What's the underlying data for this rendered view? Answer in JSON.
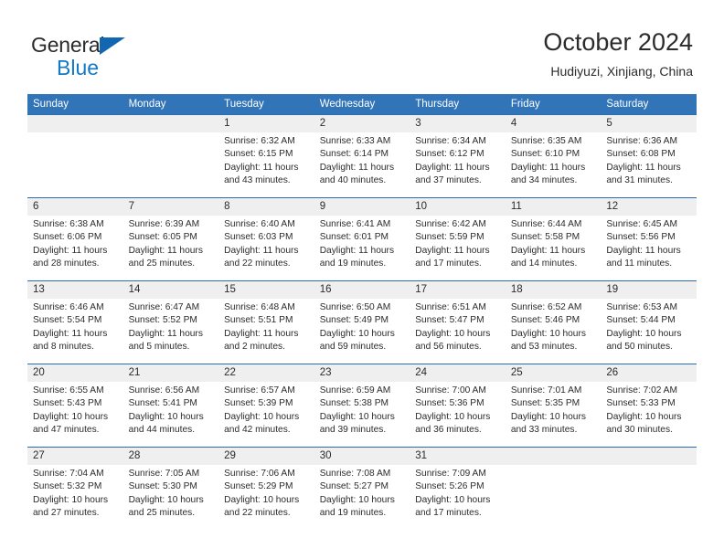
{
  "brand": {
    "name_part1": "General",
    "name_part2": "Blue",
    "triangle_color": "#1267b3",
    "blue_color": "#1479c4"
  },
  "header": {
    "title": "October 2024",
    "subtitle": "Hudiyuzi, Xinjiang, China"
  },
  "theme": {
    "header_bg": "#3174b8",
    "row_divider": "#2a6cb0",
    "daynum_bg": "#efefef",
    "text": "#2b2b2b"
  },
  "calendar": {
    "weekday_headers": [
      "Sunday",
      "Monday",
      "Tuesday",
      "Wednesday",
      "Thursday",
      "Friday",
      "Saturday"
    ],
    "weeks": [
      [
        {
          "day": "",
          "sunrise": "",
          "sunset": "",
          "daylight": "",
          "daylight2": ""
        },
        {
          "day": "",
          "sunrise": "",
          "sunset": "",
          "daylight": "",
          "daylight2": ""
        },
        {
          "day": "1",
          "sunrise": "Sunrise: 6:32 AM",
          "sunset": "Sunset: 6:15 PM",
          "daylight": "Daylight: 11 hours",
          "daylight2": "and 43 minutes."
        },
        {
          "day": "2",
          "sunrise": "Sunrise: 6:33 AM",
          "sunset": "Sunset: 6:14 PM",
          "daylight": "Daylight: 11 hours",
          "daylight2": "and 40 minutes."
        },
        {
          "day": "3",
          "sunrise": "Sunrise: 6:34 AM",
          "sunset": "Sunset: 6:12 PM",
          "daylight": "Daylight: 11 hours",
          "daylight2": "and 37 minutes."
        },
        {
          "day": "4",
          "sunrise": "Sunrise: 6:35 AM",
          "sunset": "Sunset: 6:10 PM",
          "daylight": "Daylight: 11 hours",
          "daylight2": "and 34 minutes."
        },
        {
          "day": "5",
          "sunrise": "Sunrise: 6:36 AM",
          "sunset": "Sunset: 6:08 PM",
          "daylight": "Daylight: 11 hours",
          "daylight2": "and 31 minutes."
        }
      ],
      [
        {
          "day": "6",
          "sunrise": "Sunrise: 6:38 AM",
          "sunset": "Sunset: 6:06 PM",
          "daylight": "Daylight: 11 hours",
          "daylight2": "and 28 minutes."
        },
        {
          "day": "7",
          "sunrise": "Sunrise: 6:39 AM",
          "sunset": "Sunset: 6:05 PM",
          "daylight": "Daylight: 11 hours",
          "daylight2": "and 25 minutes."
        },
        {
          "day": "8",
          "sunrise": "Sunrise: 6:40 AM",
          "sunset": "Sunset: 6:03 PM",
          "daylight": "Daylight: 11 hours",
          "daylight2": "and 22 minutes."
        },
        {
          "day": "9",
          "sunrise": "Sunrise: 6:41 AM",
          "sunset": "Sunset: 6:01 PM",
          "daylight": "Daylight: 11 hours",
          "daylight2": "and 19 minutes."
        },
        {
          "day": "10",
          "sunrise": "Sunrise: 6:42 AM",
          "sunset": "Sunset: 5:59 PM",
          "daylight": "Daylight: 11 hours",
          "daylight2": "and 17 minutes."
        },
        {
          "day": "11",
          "sunrise": "Sunrise: 6:44 AM",
          "sunset": "Sunset: 5:58 PM",
          "daylight": "Daylight: 11 hours",
          "daylight2": "and 14 minutes."
        },
        {
          "day": "12",
          "sunrise": "Sunrise: 6:45 AM",
          "sunset": "Sunset: 5:56 PM",
          "daylight": "Daylight: 11 hours",
          "daylight2": "and 11 minutes."
        }
      ],
      [
        {
          "day": "13",
          "sunrise": "Sunrise: 6:46 AM",
          "sunset": "Sunset: 5:54 PM",
          "daylight": "Daylight: 11 hours",
          "daylight2": "and 8 minutes."
        },
        {
          "day": "14",
          "sunrise": "Sunrise: 6:47 AM",
          "sunset": "Sunset: 5:52 PM",
          "daylight": "Daylight: 11 hours",
          "daylight2": "and 5 minutes."
        },
        {
          "day": "15",
          "sunrise": "Sunrise: 6:48 AM",
          "sunset": "Sunset: 5:51 PM",
          "daylight": "Daylight: 11 hours",
          "daylight2": "and 2 minutes."
        },
        {
          "day": "16",
          "sunrise": "Sunrise: 6:50 AM",
          "sunset": "Sunset: 5:49 PM",
          "daylight": "Daylight: 10 hours",
          "daylight2": "and 59 minutes."
        },
        {
          "day": "17",
          "sunrise": "Sunrise: 6:51 AM",
          "sunset": "Sunset: 5:47 PM",
          "daylight": "Daylight: 10 hours",
          "daylight2": "and 56 minutes."
        },
        {
          "day": "18",
          "sunrise": "Sunrise: 6:52 AM",
          "sunset": "Sunset: 5:46 PM",
          "daylight": "Daylight: 10 hours",
          "daylight2": "and 53 minutes."
        },
        {
          "day": "19",
          "sunrise": "Sunrise: 6:53 AM",
          "sunset": "Sunset: 5:44 PM",
          "daylight": "Daylight: 10 hours",
          "daylight2": "and 50 minutes."
        }
      ],
      [
        {
          "day": "20",
          "sunrise": "Sunrise: 6:55 AM",
          "sunset": "Sunset: 5:43 PM",
          "daylight": "Daylight: 10 hours",
          "daylight2": "and 47 minutes."
        },
        {
          "day": "21",
          "sunrise": "Sunrise: 6:56 AM",
          "sunset": "Sunset: 5:41 PM",
          "daylight": "Daylight: 10 hours",
          "daylight2": "and 44 minutes."
        },
        {
          "day": "22",
          "sunrise": "Sunrise: 6:57 AM",
          "sunset": "Sunset: 5:39 PM",
          "daylight": "Daylight: 10 hours",
          "daylight2": "and 42 minutes."
        },
        {
          "day": "23",
          "sunrise": "Sunrise: 6:59 AM",
          "sunset": "Sunset: 5:38 PM",
          "daylight": "Daylight: 10 hours",
          "daylight2": "and 39 minutes."
        },
        {
          "day": "24",
          "sunrise": "Sunrise: 7:00 AM",
          "sunset": "Sunset: 5:36 PM",
          "daylight": "Daylight: 10 hours",
          "daylight2": "and 36 minutes."
        },
        {
          "day": "25",
          "sunrise": "Sunrise: 7:01 AM",
          "sunset": "Sunset: 5:35 PM",
          "daylight": "Daylight: 10 hours",
          "daylight2": "and 33 minutes."
        },
        {
          "day": "26",
          "sunrise": "Sunrise: 7:02 AM",
          "sunset": "Sunset: 5:33 PM",
          "daylight": "Daylight: 10 hours",
          "daylight2": "and 30 minutes."
        }
      ],
      [
        {
          "day": "27",
          "sunrise": "Sunrise: 7:04 AM",
          "sunset": "Sunset: 5:32 PM",
          "daylight": "Daylight: 10 hours",
          "daylight2": "and 27 minutes."
        },
        {
          "day": "28",
          "sunrise": "Sunrise: 7:05 AM",
          "sunset": "Sunset: 5:30 PM",
          "daylight": "Daylight: 10 hours",
          "daylight2": "and 25 minutes."
        },
        {
          "day": "29",
          "sunrise": "Sunrise: 7:06 AM",
          "sunset": "Sunset: 5:29 PM",
          "daylight": "Daylight: 10 hours",
          "daylight2": "and 22 minutes."
        },
        {
          "day": "30",
          "sunrise": "Sunrise: 7:08 AM",
          "sunset": "Sunset: 5:27 PM",
          "daylight": "Daylight: 10 hours",
          "daylight2": "and 19 minutes."
        },
        {
          "day": "31",
          "sunrise": "Sunrise: 7:09 AM",
          "sunset": "Sunset: 5:26 PM",
          "daylight": "Daylight: 10 hours",
          "daylight2": "and 17 minutes."
        },
        {
          "day": "",
          "sunrise": "",
          "sunset": "",
          "daylight": "",
          "daylight2": ""
        },
        {
          "day": "",
          "sunrise": "",
          "sunset": "",
          "daylight": "",
          "daylight2": ""
        }
      ]
    ]
  }
}
